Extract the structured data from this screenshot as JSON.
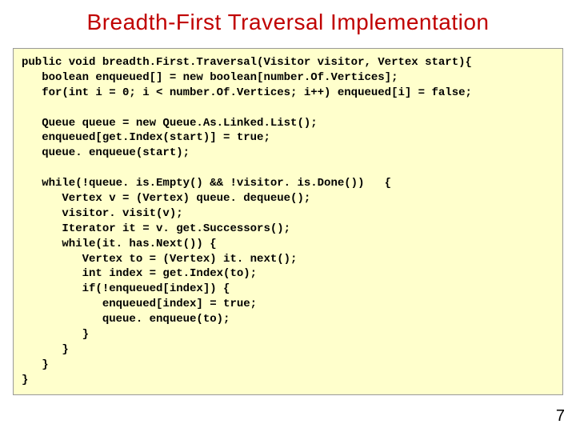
{
  "title": "Breadth-First Traversal Implementation",
  "code_lines": [
    "public void breadth.First.Traversal(Visitor visitor, Vertex start){",
    "   boolean enqueued[] = new boolean[number.Of.Vertices];",
    "   for(int i = 0; i < number.Of.Vertices; i++) enqueued[i] = false;",
    "",
    "   Queue queue = new Queue.As.Linked.List();",
    "   enqueued[get.Index(start)] = true;",
    "   queue. enqueue(start);",
    "",
    "   while(!queue. is.Empty() && !visitor. is.Done())   {",
    "      Vertex v = (Vertex) queue. dequeue();",
    "      visitor. visit(v);",
    "      Iterator it = v. get.Successors();",
    "      while(it. has.Next()) {",
    "         Vertex to = (Vertex) it. next();",
    "         int index = get.Index(to);",
    "         if(!enqueued[index]) {",
    "            enqueued[index] = true;",
    "            queue. enqueue(to);",
    "         }",
    "      }",
    "   }",
    "}"
  ],
  "page_number": "7"
}
